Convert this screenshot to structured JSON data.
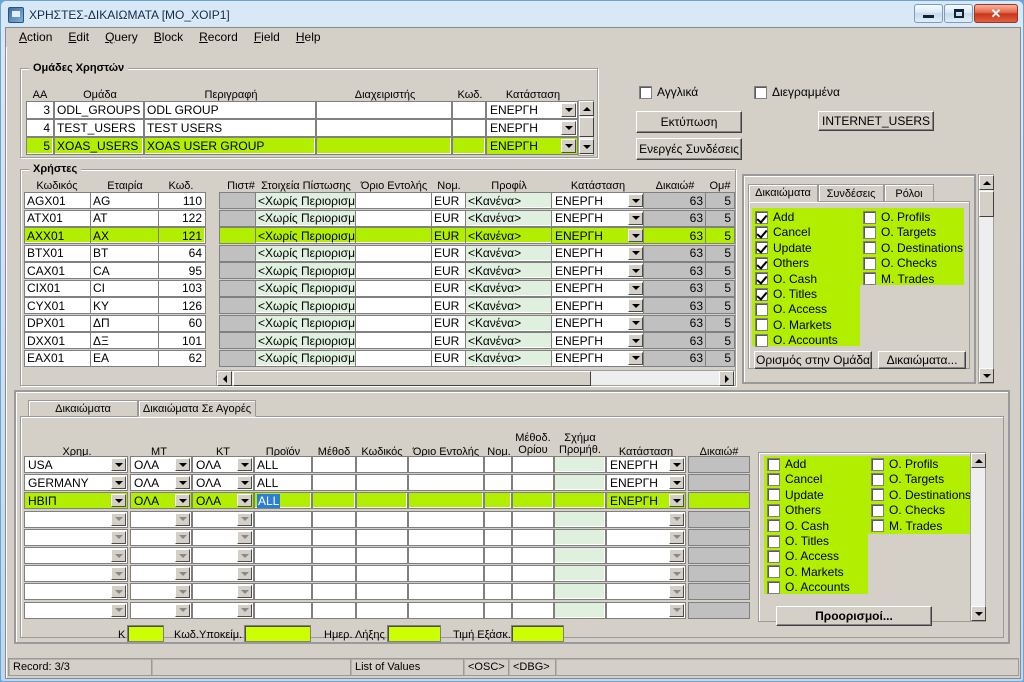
{
  "window": {
    "title": "ΧΡΗΣΤΕΣ-ΔΙΚΑΙΩΜΑΤΑ [MO_XOIP1]",
    "icon": "app-icon",
    "minimize": "—",
    "maximize": "□",
    "close": "✕"
  },
  "menubar": {
    "items": [
      {
        "label": "Action"
      },
      {
        "label": "Edit"
      },
      {
        "label": "Query"
      },
      {
        "label": "Block"
      },
      {
        "label": "Record"
      },
      {
        "label": "Field"
      },
      {
        "label": "Help"
      }
    ]
  },
  "groups_panel": {
    "legend": "Ομάδες Χρηστών",
    "headers": [
      "AA",
      "Ομάδα",
      "Περιγραφή",
      "Διαχειριστής",
      "Κωδ.",
      "Κατάσταση"
    ],
    "rows": [
      {
        "aa": "3",
        "group": "ODL_GROUPS",
        "desc": "ODL GROUP",
        "admin": "",
        "code": "",
        "status": "ΕΝΕΡΓΗ",
        "selected": false
      },
      {
        "aa": "4",
        "group": "TEST_USERS",
        "desc": "TEST USERS",
        "admin": "",
        "code": "",
        "status": "ΕΝΕΡΓΗ",
        "selected": false
      },
      {
        "aa": "5",
        "group": "XOAS_USERS",
        "desc": "XOAS USER GROUP",
        "admin": "",
        "code": "",
        "status": "ΕΝΕΡΓΗ",
        "selected": true
      }
    ]
  },
  "top_options": {
    "checkbox_english": {
      "label": "Αγγλικά",
      "checked": false
    },
    "checkbox_deleted": {
      "label": "Διεγραμμένα",
      "checked": false
    },
    "button_print": "Εκτύπωση",
    "button_active_connections": "Ενεργές Συνδέσεις",
    "button_internet_users": "INTERNET_USERS"
  },
  "users_panel": {
    "legend": "Χρήστες",
    "headers": [
      "Κωδικός",
      "Εταιρία",
      "Κωδ.",
      "Πιστ#",
      "Στοιχεία Πίστωσης",
      "Όριο Εντολής",
      "Νομ.",
      "Προφίλ",
      "Κατάσταση",
      "Δικαιώ#",
      "Ομ#"
    ],
    "rows": [
      {
        "code": "AGX01",
        "company": "AG",
        "num": "110",
        "credit_no": "",
        "credit_info": "<Χωρίς Περιορισμό>",
        "limit": "",
        "cur": "EUR",
        "profile": "<Κανένα>",
        "status": "ΕΝΕΡΓΗ",
        "rights": "63",
        "grp": "5",
        "selected": false
      },
      {
        "code": "ATX01",
        "company": "AT",
        "num": "122",
        "credit_no": "",
        "credit_info": "<Χωρίς Περιορισμό>",
        "limit": "",
        "cur": "EUR",
        "profile": "<Κανένα>",
        "status": "ΕΝΕΡΓΗ",
        "rights": "63",
        "grp": "5",
        "selected": false
      },
      {
        "code": "AXX01",
        "company": "AX",
        "num": "121",
        "credit_no": "",
        "credit_info": "<Χωρίς Περιορισμό>",
        "limit": "",
        "cur": "EUR",
        "profile": "<Κανένα>",
        "status": "ΕΝΕΡΓΗ",
        "rights": "63",
        "grp": "5",
        "selected": true
      },
      {
        "code": "BTX01",
        "company": "BT",
        "num": "64",
        "credit_no": "",
        "credit_info": "<Χωρίς Περιορισμό>",
        "limit": "",
        "cur": "EUR",
        "profile": "<Κανένα>",
        "status": "ΕΝΕΡΓΗ",
        "rights": "63",
        "grp": "5",
        "selected": false
      },
      {
        "code": "CAX01",
        "company": "CA",
        "num": "95",
        "credit_no": "",
        "credit_info": "<Χωρίς Περιορισμό>",
        "limit": "",
        "cur": "EUR",
        "profile": "<Κανένα>",
        "status": "ΕΝΕΡΓΗ",
        "rights": "63",
        "grp": "5",
        "selected": false
      },
      {
        "code": "CIX01",
        "company": "CI",
        "num": "103",
        "credit_no": "",
        "credit_info": "<Χωρίς Περιορισμό>",
        "limit": "",
        "cur": "EUR",
        "profile": "<Κανένα>",
        "status": "ΕΝΕΡΓΗ",
        "rights": "63",
        "grp": "5",
        "selected": false
      },
      {
        "code": "CYX01",
        "company": "ΚΥ",
        "num": "126",
        "credit_no": "",
        "credit_info": "<Χωρίς Περιορισμό>",
        "limit": "",
        "cur": "EUR",
        "profile": "<Κανένα>",
        "status": "ΕΝΕΡΓΗ",
        "rights": "63",
        "grp": "5",
        "selected": false
      },
      {
        "code": "DPX01",
        "company": "ΔΠ",
        "num": "60",
        "credit_no": "",
        "credit_info": "<Χωρίς Περιορισμό>",
        "limit": "",
        "cur": "EUR",
        "profile": "<Κανένα>",
        "status": "ΕΝΕΡΓΗ",
        "rights": "63",
        "grp": "5",
        "selected": false
      },
      {
        "code": "DXX01",
        "company": "ΔΞ",
        "num": "101",
        "credit_no": "",
        "credit_info": "<Χωρίς Περιορισμό>",
        "limit": "",
        "cur": "EUR",
        "profile": "<Κανένα>",
        "status": "ΕΝΕΡΓΗ",
        "rights": "63",
        "grp": "5",
        "selected": false
      },
      {
        "code": "EAX01",
        "company": "EA",
        "num": "62",
        "credit_no": "",
        "credit_info": "<Χωρίς Περιορισμό>",
        "limit": "",
        "cur": "EUR",
        "profile": "<Κανένα>",
        "status": "ΕΝΕΡΓΗ",
        "rights": "63",
        "grp": "5",
        "selected": false
      }
    ]
  },
  "rights_panel": {
    "tabs": [
      {
        "label": "Δικαιώματα",
        "active": true
      },
      {
        "label": "Συνδέσεις",
        "active": false
      },
      {
        "label": "Ρόλοι",
        "active": false
      }
    ],
    "left_column": [
      {
        "label": "Add",
        "checked": true
      },
      {
        "label": "Cancel",
        "checked": true
      },
      {
        "label": "Update",
        "checked": true
      },
      {
        "label": "Others",
        "checked": true
      },
      {
        "label": "O. Cash",
        "checked": true
      },
      {
        "label": "O. Titles",
        "checked": true
      },
      {
        "label": "O. Access",
        "checked": false
      },
      {
        "label": "O. Markets",
        "checked": false
      },
      {
        "label": "O. Accounts",
        "checked": false
      }
    ],
    "right_column": [
      {
        "label": "O. Profils",
        "checked": false
      },
      {
        "label": "O. Targets",
        "checked": false
      },
      {
        "label": "O. Destinations",
        "checked": false
      },
      {
        "label": "O. Checks",
        "checked": false
      },
      {
        "label": "M. Trades",
        "checked": false
      }
    ],
    "button_assign_group": "Ορισμός στην Ομάδα",
    "button_rights": "Δικαιώματα..."
  },
  "bottom_panel": {
    "tabs": [
      {
        "label": "Δικαιώματα",
        "active": false
      },
      {
        "label": "Δικαιώματα Σε Αγορές",
        "active": true
      }
    ],
    "headers": [
      "Χρημ.",
      "ΜΤ",
      "ΚΤ",
      "Προϊόν",
      "Μέθοδ",
      "Κωδικός",
      "Όριο Εντολής",
      "Νομ.",
      "Μέθοδ. Ορίου",
      "Σχήμα Προμήθ.",
      "Κατάσταση",
      "Δικαιώ#"
    ],
    "rows": [
      {
        "market": "USA",
        "mt": "ΟΛΑ",
        "kt": "ΟΛΑ",
        "product": "ALL",
        "method": "",
        "code": "",
        "limit": "",
        "cur": "",
        "limit_method": "",
        "comm_scheme": "",
        "status": "ΕΝΕΡΓΗ",
        "rights": "",
        "selected": false,
        "product_highlight": false
      },
      {
        "market": "GERMANY",
        "mt": "ΟΛΑ",
        "kt": "ΟΛΑ",
        "product": "ALL",
        "method": "",
        "code": "",
        "limit": "",
        "cur": "",
        "limit_method": "",
        "comm_scheme": "",
        "status": "ΕΝΕΡΓΗ",
        "rights": "",
        "selected": false,
        "product_highlight": false
      },
      {
        "market": "ΗΒΙΠ",
        "mt": "ΟΛΑ",
        "kt": "ΟΛΑ",
        "product": "ALL",
        "method": "",
        "code": "",
        "limit": "",
        "cur": "",
        "limit_method": "",
        "comm_scheme": "",
        "status": "ΕΝΕΡΓΗ",
        "rights": "",
        "selected": true,
        "product_highlight": true
      },
      {
        "market": "",
        "mt": "",
        "kt": "",
        "product": "",
        "method": "",
        "code": "",
        "limit": "",
        "cur": "",
        "limit_method": "",
        "comm_scheme": "",
        "status": "",
        "rights": "",
        "selected": false,
        "product_highlight": false
      },
      {
        "market": "",
        "mt": "",
        "kt": "",
        "product": "",
        "method": "",
        "code": "",
        "limit": "",
        "cur": "",
        "limit_method": "",
        "comm_scheme": "",
        "status": "",
        "rights": "",
        "selected": false,
        "product_highlight": false
      },
      {
        "market": "",
        "mt": "",
        "kt": "",
        "product": "",
        "method": "",
        "code": "",
        "limit": "",
        "cur": "",
        "limit_method": "",
        "comm_scheme": "",
        "status": "",
        "rights": "",
        "selected": false,
        "product_highlight": false
      },
      {
        "market": "",
        "mt": "",
        "kt": "",
        "product": "",
        "method": "",
        "code": "",
        "limit": "",
        "cur": "",
        "limit_method": "",
        "comm_scheme": "",
        "status": "",
        "rights": "",
        "selected": false,
        "product_highlight": false
      },
      {
        "market": "",
        "mt": "",
        "kt": "",
        "product": "",
        "method": "",
        "code": "",
        "limit": "",
        "cur": "",
        "limit_method": "",
        "comm_scheme": "",
        "status": "",
        "rights": "",
        "selected": false,
        "product_highlight": false
      },
      {
        "market": "",
        "mt": "",
        "kt": "",
        "product": "",
        "method": "",
        "code": "",
        "limit": "",
        "cur": "",
        "limit_method": "",
        "comm_scheme": "",
        "status": "",
        "rights": "",
        "selected": false,
        "product_highlight": false
      }
    ],
    "rights_left_column": [
      {
        "label": "Add",
        "checked": false
      },
      {
        "label": "Cancel",
        "checked": false
      },
      {
        "label": "Update",
        "checked": false
      },
      {
        "label": "Others",
        "checked": false
      },
      {
        "label": "O. Cash",
        "checked": false
      },
      {
        "label": "O. Titles",
        "checked": false
      },
      {
        "label": "O. Access",
        "checked": false
      },
      {
        "label": "O. Markets",
        "checked": false
      },
      {
        "label": "O. Accounts",
        "checked": false
      }
    ],
    "rights_right_column": [
      {
        "label": "O. Profils",
        "checked": false
      },
      {
        "label": "O. Targets",
        "checked": false
      },
      {
        "label": "O. Destinations",
        "checked": false
      },
      {
        "label": "O. Checks",
        "checked": false
      },
      {
        "label": "M. Trades",
        "checked": false
      }
    ],
    "button_destinations": "Προορισμοί...",
    "footer_fields": [
      {
        "label": "Κ",
        "value": ""
      },
      {
        "label": "Κωδ.Υποκείμ.",
        "value": ""
      },
      {
        "label": "Ημερ. Λήξης",
        "value": ""
      },
      {
        "label": "Τιμή Εξάσκ.",
        "value": ""
      }
    ]
  },
  "statusbar": {
    "record": "Record: 3/3",
    "blank": "",
    "list_of_values": "List of Values",
    "osc": "<OSC>",
    "dbg": "<DBG>",
    "tail": ""
  },
  "colors": {
    "selection_green": "#b2ee00",
    "field_light_green": "#dff0df",
    "yellow_field": "#ccff00",
    "face": "#d4d0c8"
  }
}
